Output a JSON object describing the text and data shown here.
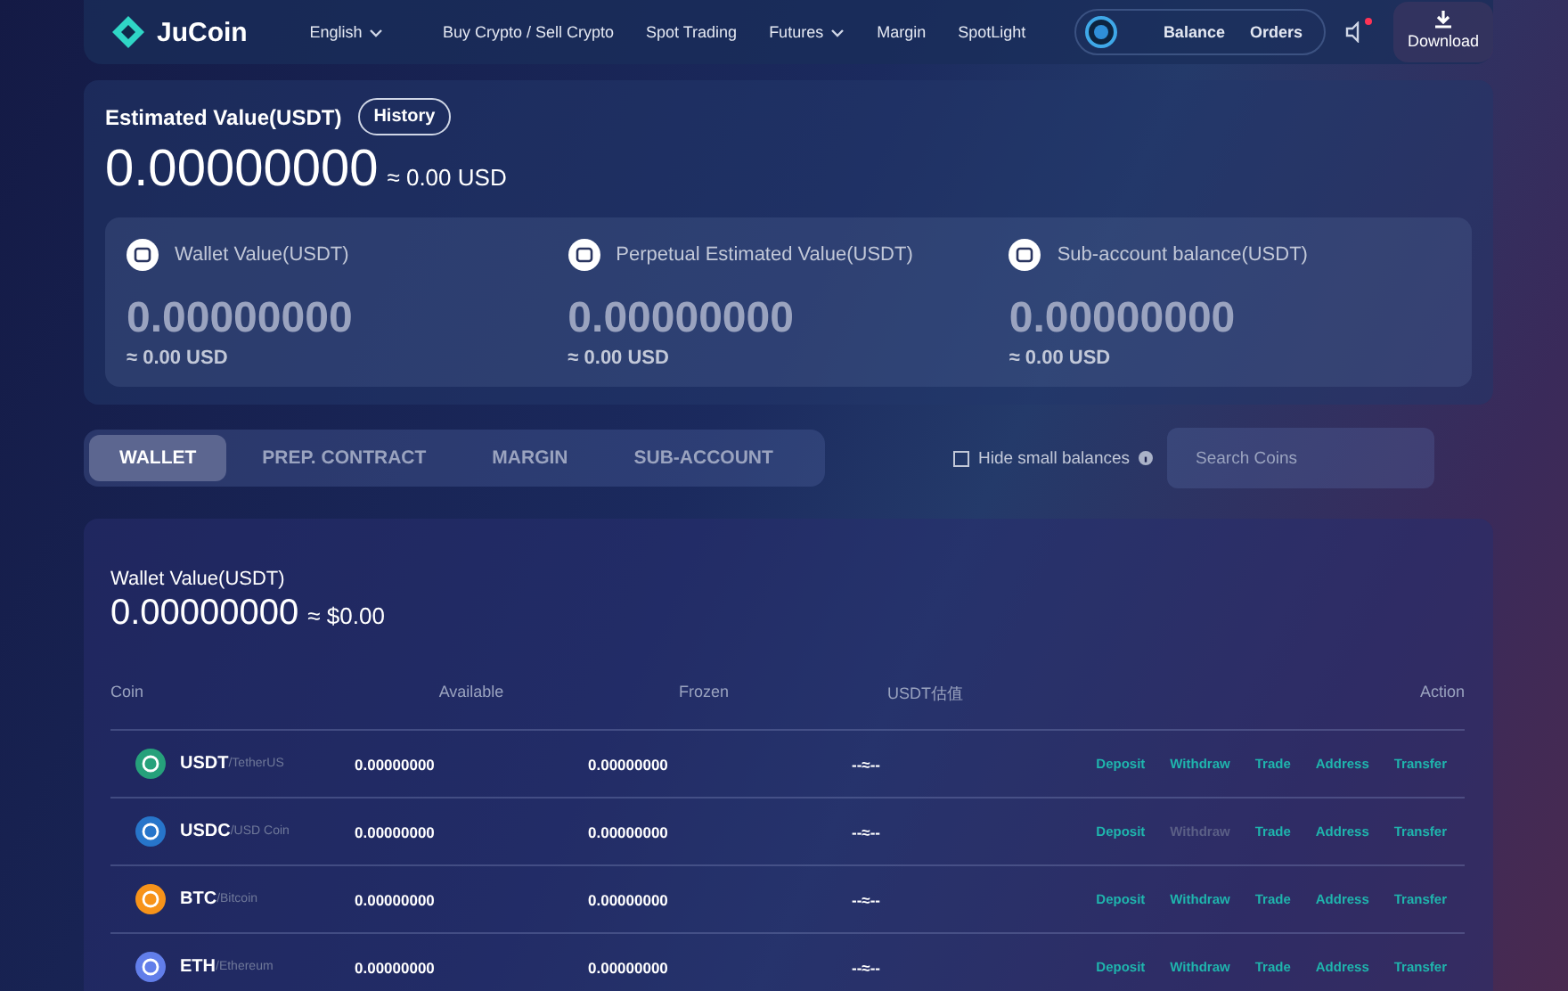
{
  "header": {
    "logo": "JuCoin",
    "language": "English",
    "nav": [
      {
        "label": "Buy Crypto / Sell Crypto",
        "dropdown": false
      },
      {
        "label": "Spot Trading",
        "dropdown": false
      },
      {
        "label": "Futures",
        "dropdown": true
      },
      {
        "label": "Margin",
        "dropdown": false
      },
      {
        "label": "SpotLight",
        "dropdown": false
      }
    ],
    "account_links": [
      "Balance",
      "Orders"
    ],
    "notification_dot": true,
    "download": "Download"
  },
  "overview": {
    "title": "Estimated Value(USDT)",
    "history_button": "History",
    "value": "0.00000000",
    "approx": "≈ 0.00 USD",
    "cards": [
      {
        "label": "Wallet Value(USDT)",
        "value": "0.00000000",
        "approx": "≈ 0.00 USD"
      },
      {
        "label": "Perpetual Estimated Value(USDT)",
        "value": "0.00000000",
        "approx": "≈ 0.00 USD"
      },
      {
        "label": "Sub-account balance(USDT)",
        "value": "0.00000000",
        "approx": "≈ 0.00 USD"
      }
    ]
  },
  "tabs": [
    {
      "label": "WALLET",
      "selected": true
    },
    {
      "label": "PREP. CONTRACT",
      "selected": false
    },
    {
      "label": "MARGIN",
      "selected": false
    },
    {
      "label": "SUB-ACCOUNT",
      "selected": false
    }
  ],
  "hide_small": {
    "label": "Hide small balances",
    "checked": false
  },
  "search": {
    "placeholder": "Search Coins"
  },
  "wallet": {
    "title": "Wallet Value(USDT)",
    "value": "0.00000000",
    "approx": "≈ $0.00",
    "columns": [
      "Coin",
      "Available",
      "Frozen",
      "USDT估值",
      "Action"
    ],
    "rows": [
      {
        "coin": "USDT",
        "name": "/TetherUS",
        "color": "#26a17b",
        "available": "0.00000000",
        "frozen": "0.00000000",
        "usdt_value": "--≈--",
        "actions": [
          {
            "label": "Deposit",
            "disabled": false
          },
          {
            "label": "Withdraw",
            "disabled": false
          },
          {
            "label": "Trade",
            "disabled": false
          },
          {
            "label": "Address",
            "disabled": false
          },
          {
            "label": "Transfer",
            "disabled": false
          }
        ]
      },
      {
        "coin": "USDC",
        "name": "/USD Coin",
        "color": "#2775ca",
        "available": "0.00000000",
        "frozen": "0.00000000",
        "usdt_value": "--≈--",
        "actions": [
          {
            "label": "Deposit",
            "disabled": false
          },
          {
            "label": "Withdraw",
            "disabled": true
          },
          {
            "label": "Trade",
            "disabled": false
          },
          {
            "label": "Address",
            "disabled": false
          },
          {
            "label": "Transfer",
            "disabled": false
          }
        ]
      },
      {
        "coin": "BTC",
        "name": "/Bitcoin",
        "color": "#f7931a",
        "available": "0.00000000",
        "frozen": "0.00000000",
        "usdt_value": "--≈--",
        "actions": [
          {
            "label": "Deposit",
            "disabled": false
          },
          {
            "label": "Withdraw",
            "disabled": false
          },
          {
            "label": "Trade",
            "disabled": false
          },
          {
            "label": "Address",
            "disabled": false
          },
          {
            "label": "Transfer",
            "disabled": false
          }
        ]
      },
      {
        "coin": "ETH",
        "name": "/Ethereum",
        "color": "#627eea",
        "available": "0.00000000",
        "frozen": "0.00000000",
        "usdt_value": "--≈--",
        "actions": [
          {
            "label": "Deposit",
            "disabled": false
          },
          {
            "label": "Withdraw",
            "disabled": false
          },
          {
            "label": "Trade",
            "disabled": false
          },
          {
            "label": "Address",
            "disabled": false
          },
          {
            "label": "Transfer",
            "disabled": false
          }
        ]
      }
    ]
  }
}
